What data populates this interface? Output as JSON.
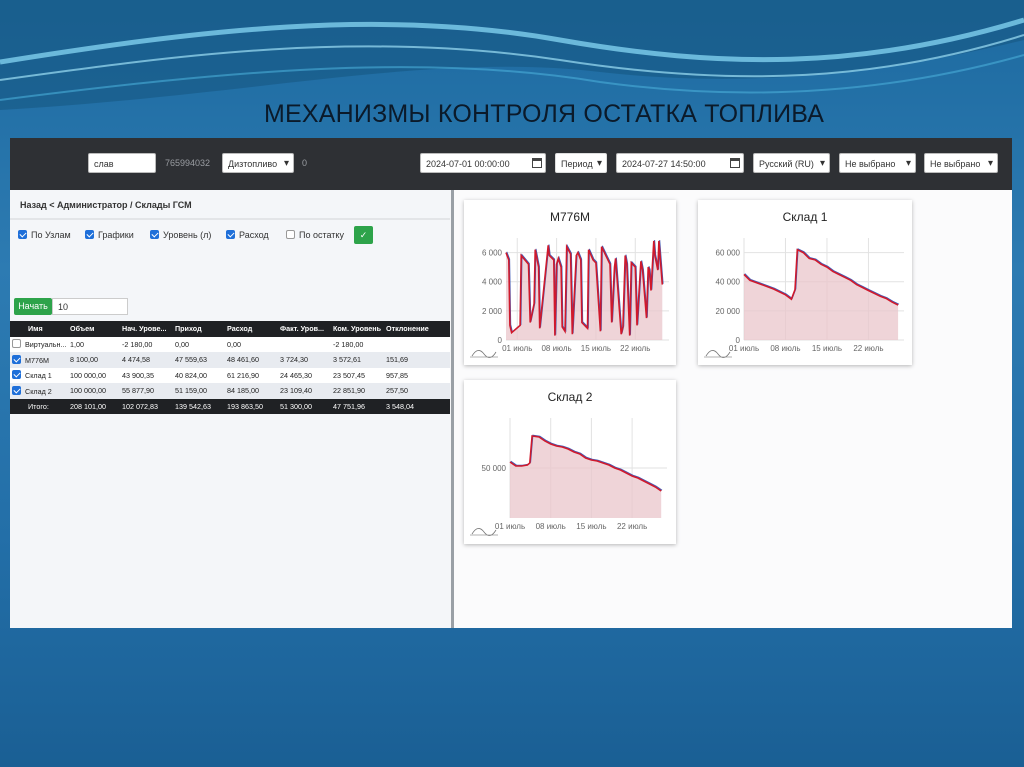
{
  "slide": {
    "title": "МЕХАНИЗМЫ КОНТРОЛЯ ОСТАТКА ТОПЛИВА"
  },
  "colors": {
    "slide_bg": "#236fa8",
    "topbar": "#2e3034",
    "checkbox": "#1e6fd9",
    "button": "#2da34a",
    "line": "#d0192c",
    "fill": "#e9c6cb"
  },
  "toolbar": {
    "search_value": "слав",
    "id_text": "765994032",
    "fuel_select": "Дизтопливо",
    "count": "0",
    "date_from": "2024-07-01 00:00:00",
    "period_label": "Период",
    "date_to": "2024-07-27 14:50:00",
    "language": "Русский (RU)",
    "filter1": "Не выбрано",
    "filter2": "Не выбрано",
    "calendar_icon": "calendar-icon"
  },
  "breadcrumb": "Назад < Администратор / Склады ГСМ",
  "options": [
    {
      "label": "По Узлам",
      "checked": true
    },
    {
      "label": "Графики",
      "checked": true
    },
    {
      "label": "Уровень (л)",
      "checked": true
    },
    {
      "label": "Расход",
      "checked": true
    },
    {
      "label": "По остатку",
      "checked": false
    }
  ],
  "apply_icon": "check-icon",
  "start_button": "Начать",
  "start_value": "10",
  "table": {
    "columns": [
      "Имя",
      "Объем",
      "Нач. Урове...",
      "Приход",
      "Расход",
      "Факт. Уров...",
      "Ком. Уровень",
      "Отклонение"
    ],
    "rows": [
      {
        "checked": false,
        "cells": [
          "Виртуальн...",
          "1,00",
          "-2 180,00",
          "0,00",
          "0,00",
          "",
          "-2 180,00",
          ""
        ]
      },
      {
        "checked": true,
        "cells": [
          "М776М",
          "8 100,00",
          "4 474,58",
          "47 559,63",
          "48 461,60",
          "3 724,30",
          "3 572,61",
          "151,69"
        ]
      },
      {
        "checked": true,
        "cells": [
          "Склад 1",
          "100 000,00",
          "43 900,35",
          "40 824,00",
          "61 216,90",
          "24 465,30",
          "23 507,45",
          "957,85"
        ]
      },
      {
        "checked": true,
        "cells": [
          "Склад 2",
          "100 000,00",
          "55 877,90",
          "51 159,00",
          "84 185,00",
          "23 109,40",
          "22 851,90",
          "257,50"
        ]
      }
    ],
    "totals": [
      "Итого:",
      "208 101,00",
      "102 072,83",
      "139 542,63",
      "193 863,50",
      "51 300,00",
      "47 751,96",
      "3 548,04"
    ]
  },
  "chart_data": [
    {
      "type": "line",
      "title": "М776М",
      "xticks": [
        "01 июль",
        "08 июль",
        "15 июль",
        "22 июль"
      ],
      "yticks": [
        "0",
        "2 000",
        "4 000",
        "6 000"
      ],
      "ylim": [
        0,
        7000
      ],
      "xlim": [
        -2,
        27
      ],
      "series": [
        {
          "x": [
            -2,
            -1.5,
            -1.3,
            -1,
            0.5,
            0.7,
            2,
            2.3,
            3,
            3.2,
            3.8,
            4,
            5.5,
            5.7,
            6.5,
            6.7,
            7,
            7.3,
            7.8,
            8,
            8.5,
            8.8,
            9.5,
            9.8,
            10.5,
            10.8,
            11.3,
            11.5,
            12.5,
            12.7,
            13.5,
            14,
            14.8,
            15,
            16.5,
            16.8,
            17.3,
            17.5,
            18.5,
            18.8,
            19.2,
            19.5,
            20,
            20.3,
            21,
            21.3,
            22,
            22.3,
            23,
            23.3,
            23.5,
            23.8,
            24.3,
            24.5,
            25,
            25.2,
            25.8
          ],
          "y": [
            6000,
            5500,
            1000,
            500,
            1000,
            5800,
            5200,
            1200,
            2500,
            6200,
            5000,
            800,
            6500,
            5800,
            5500,
            300,
            5200,
            5600,
            5000,
            900,
            600,
            6400,
            5900,
            400,
            5800,
            6000,
            5500,
            1200,
            800,
            6200,
            5500,
            5300,
            600,
            6400,
            5200,
            1200,
            5000,
            5600,
            400,
            900,
            5800,
            5200,
            300,
            5300,
            5000,
            1000,
            5400,
            4800,
            1500,
            5000,
            4800,
            3400,
            6800,
            5800,
            4800,
            6800,
            3800
          ]
        }
      ]
    },
    {
      "type": "area",
      "title": "Склад 1",
      "xticks": [
        "01 июль",
        "08 июль",
        "15 июль",
        "22 июль"
      ],
      "yticks": [
        "0",
        "20 000",
        "40 000",
        "60 000"
      ],
      "ylim": [
        0,
        70000
      ],
      "xlim": [
        0,
        27
      ],
      "series": [
        {
          "x": [
            0,
            1,
            3,
            5,
            7,
            8,
            8.6,
            9,
            10,
            11,
            12,
            13,
            14,
            15,
            16,
            17,
            18,
            19,
            20,
            21,
            22,
            23,
            24,
            25,
            26
          ],
          "y": [
            45000,
            41000,
            38000,
            35000,
            31000,
            28000,
            34500,
            62000,
            60000,
            56000,
            55000,
            52000,
            50000,
            47000,
            45000,
            43000,
            41000,
            38000,
            36000,
            34000,
            32000,
            30000,
            28500,
            26000,
            24000
          ]
        }
      ]
    },
    {
      "type": "area",
      "title": "Склад 2",
      "xticks": [
        "01 июль",
        "08 июль",
        "15 июль",
        "22 июль"
      ],
      "yticks": [
        "50 000"
      ],
      "ylim": [
        0,
        100000
      ],
      "xlim": [
        0,
        27
      ],
      "series": [
        {
          "x": [
            0,
            1,
            2,
            3,
            3.4,
            3.8,
            5,
            6,
            7,
            8,
            9,
            10,
            11,
            12,
            13,
            14,
            15,
            16,
            17,
            18,
            19,
            20,
            21,
            22,
            23,
            24,
            25,
            26
          ],
          "y": [
            56000,
            52000,
            52000,
            53000,
            55000,
            82000,
            81000,
            77000,
            74000,
            72000,
            71000,
            69000,
            66000,
            64000,
            60000,
            58000,
            57000,
            55000,
            53000,
            50000,
            48000,
            45000,
            42000,
            40000,
            37000,
            34000,
            31000,
            27000
          ]
        }
      ]
    }
  ]
}
